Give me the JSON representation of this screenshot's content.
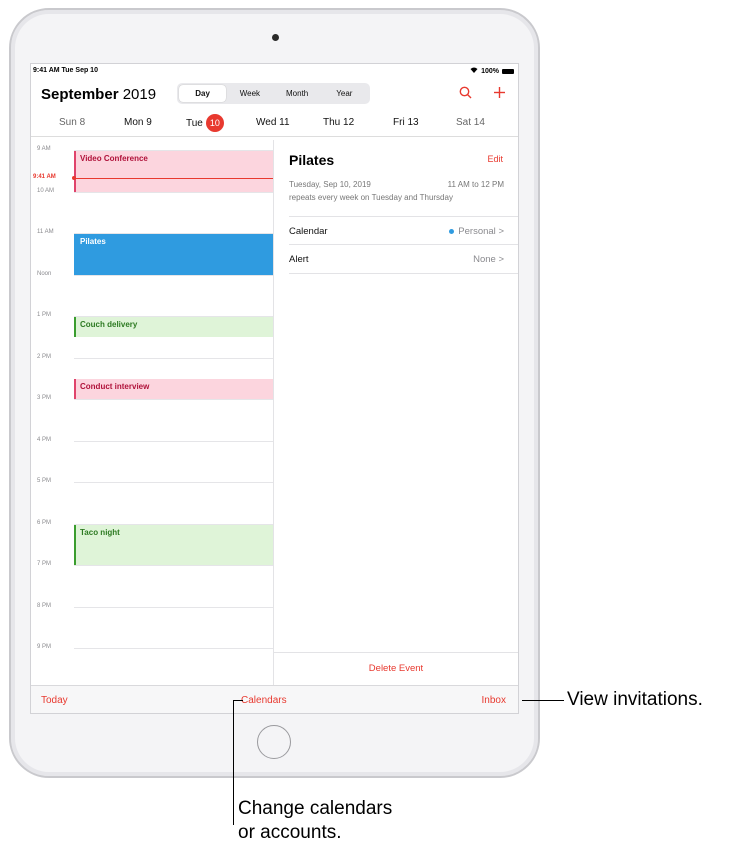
{
  "status": {
    "time": "9:41 AM  Tue Sep 10",
    "battery": "100%"
  },
  "header": {
    "month": "September",
    "year": "2019",
    "segments": [
      "Day",
      "Week",
      "Month",
      "Year"
    ],
    "active_segment": "Day",
    "search_icon": "search-icon",
    "add_icon": "plus-icon"
  },
  "days": [
    {
      "label": "Sun 8"
    },
    {
      "label": "Mon 9"
    },
    {
      "label": "Tue",
      "badge": "10"
    },
    {
      "label": "Wed 11"
    },
    {
      "label": "Thu 12"
    },
    {
      "label": "Fri 13"
    },
    {
      "label": "Sat 14"
    }
  ],
  "timeline": {
    "hours": [
      "9 AM",
      "10 AM",
      "11 AM",
      "Noon",
      "1 PM",
      "2 PM",
      "3 PM",
      "4 PM",
      "5 PM",
      "6 PM",
      "7 PM",
      "8 PM",
      "9 PM"
    ],
    "now_label": "9:41 AM",
    "events": [
      {
        "title": "Video Conference",
        "start": "9:00 AM",
        "end": "10:00 AM",
        "color": "#fcd5de",
        "bar": "#e0436b",
        "text": "#b0123a"
      },
      {
        "title": "Pilates",
        "start": "11:00 AM",
        "end": "12:00 PM",
        "color": "#2f9be0",
        "bar": "#2f9be0",
        "text": "#ffffff"
      },
      {
        "title": "Couch delivery",
        "start": "1:00 PM",
        "end": "1:30 PM",
        "color": "#dff4d8",
        "bar": "#3a9d2e",
        "text": "#2d7a22"
      },
      {
        "title": "Conduct interview",
        "start": "2:30 PM",
        "end": "3:00 PM",
        "color": "#fcd5de",
        "bar": "#e0436b",
        "text": "#b0123a"
      },
      {
        "title": "Taco night",
        "start": "6:00 PM",
        "end": "7:00 PM",
        "color": "#dff4d8",
        "bar": "#3a9d2e",
        "text": "#2d7a22"
      }
    ]
  },
  "detail": {
    "title": "Pilates",
    "edit_label": "Edit",
    "date": "Tuesday, Sep 10, 2019",
    "time_range": "11 AM to 12 PM",
    "repeat": "repeats every week on Tuesday and Thursday",
    "calendar_label": "Calendar",
    "calendar_value": "Personal",
    "alert_label": "Alert",
    "alert_value": "None",
    "chevron": ">",
    "delete_label": "Delete Event"
  },
  "tabbar": {
    "today": "Today",
    "calendars": "Calendars",
    "inbox": "Inbox"
  },
  "callouts": {
    "inbox": "View invitations.",
    "calendars_line1": "Change calendars",
    "calendars_line2": "or accounts."
  },
  "colors": {
    "accent": "#e8392f",
    "personal": "#2f9be0"
  }
}
